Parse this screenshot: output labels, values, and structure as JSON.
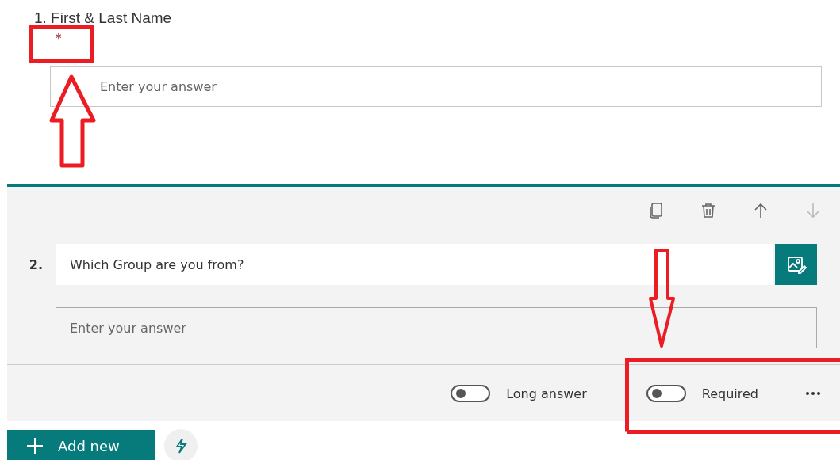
{
  "question_1": {
    "title": "1. First & Last Name",
    "required_mark": "*",
    "answer": {
      "placeholder": "Enter your answer"
    }
  },
  "question_2": {
    "number": "2.",
    "title": "Which Group are you from?",
    "answer": {
      "placeholder": "Enter your answer"
    },
    "toolbar": [
      {
        "kind": "copy",
        "disabled": false
      },
      {
        "kind": "delete",
        "disabled": false
      },
      {
        "kind": "up",
        "disabled": false
      },
      {
        "kind": "down",
        "disabled": true
      }
    ],
    "toggles": [
      {
        "label": "Long answer",
        "on": false
      },
      {
        "label": "Required",
        "on": false
      }
    ]
  },
  "add_button": {
    "label": "Add new"
  }
}
